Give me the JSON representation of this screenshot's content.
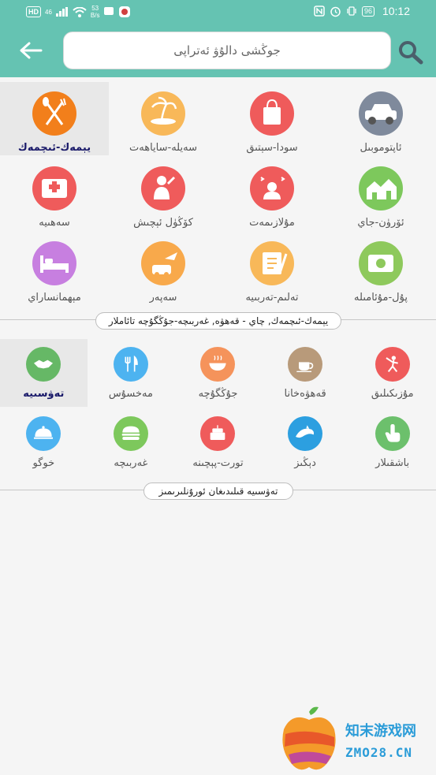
{
  "status": {
    "left": [
      "HD",
      "46",
      "53",
      "B/s"
    ],
    "battery": "96",
    "time": "10:12"
  },
  "header": {
    "search_placeholder": "جوڭشى دالۇۋ ئەتراپى"
  },
  "grid1": [
    {
      "label": "يېمەك-ئىچمەك",
      "color": "#f27f1b",
      "icon": "fork-spoon-icon",
      "selected": true
    },
    {
      "label": "سەيلە-ساياھەت",
      "color": "#f8b859",
      "icon": "beach-icon"
    },
    {
      "label": "سودا-سېتىق",
      "color": "#ef5b5b",
      "icon": "shopping-bag-icon"
    },
    {
      "label": "ئاپتوموبىل",
      "color": "#7f8a9c",
      "icon": "car-icon"
    },
    {
      "label": "سەھىيە",
      "color": "#ef5b5b",
      "icon": "hospital-icon"
    },
    {
      "label": "كۆڭۈل ئېچىش",
      "color": "#ef5b5b",
      "icon": "singer-icon"
    },
    {
      "label": "مۇلازىمەت",
      "color": "#ef5b5b",
      "icon": "service-icon"
    },
    {
      "label": "ئۆرۈن-جاي",
      "color": "#7dc85c",
      "icon": "houses-icon"
    },
    {
      "label": "مېھمانساراي",
      "color": "#c77fe0",
      "icon": "bed-icon"
    },
    {
      "label": "سەپەر",
      "color": "#f8a94b",
      "icon": "travel-icon"
    },
    {
      "label": "تەلىم-تەربىيە",
      "color": "#f8b859",
      "icon": "education-icon"
    },
    {
      "label": "پۇل-مۇئامىلە",
      "color": "#8ec95c",
      "icon": "money-icon"
    }
  ],
  "section1_title": "يېمەك-ئىچمەك, چاي - قەھۋە, غەربىچە-جۇڭگۇچە تائاملار",
  "grid2": [
    {
      "label": "تەۋسىيە",
      "color": "#66b866",
      "icon": "handshake-icon",
      "selected": true
    },
    {
      "label": "مەخسۇس",
      "color": "#4db3f0",
      "icon": "cutlery-icon"
    },
    {
      "label": "جۇڭگۇچە",
      "color": "#f5935b",
      "icon": "hotpot-icon"
    },
    {
      "label": "قەھۋەخانا",
      "color": "#b89a7a",
      "icon": "coffee-icon"
    },
    {
      "label": "مۇزىكىلىق",
      "color": "#ef5b5b",
      "icon": "dancer-icon"
    },
    {
      "label": "خوگو",
      "color": "#4db3f0",
      "icon": "cloche-icon"
    },
    {
      "label": "غەربىچە",
      "color": "#7dc85c",
      "icon": "burger-icon"
    },
    {
      "label": "تورت-پېچىنە",
      "color": "#ef5b5b",
      "icon": "cake-icon"
    },
    {
      "label": "دېڭىز",
      "color": "#2c9fe0",
      "icon": "dolphin-icon"
    },
    {
      "label": "باشقىلار",
      "color": "#6cc06c",
      "icon": "pointer-icon"
    }
  ],
  "section2_title": "تەۋسىيە قىلىدىغان ئورۇنلىرىمىز",
  "watermark": {
    "line1": "知末游戏网",
    "line2": "ZMO28.CN"
  }
}
